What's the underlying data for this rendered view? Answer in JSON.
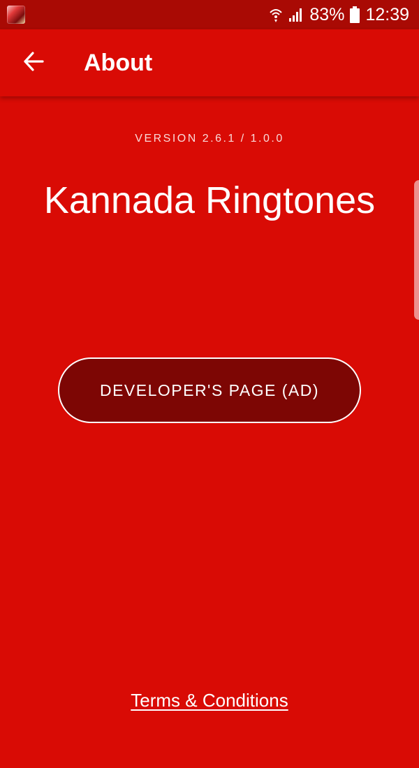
{
  "status_bar": {
    "battery_percent": "83%",
    "time": "12:39",
    "icons": [
      "notification-app-icon",
      "wifi-icon",
      "signal-icon",
      "battery-icon"
    ]
  },
  "app_bar": {
    "title": "About",
    "back_icon": "arrow-back-icon"
  },
  "about": {
    "version": "VERSION 2.6.1 / 1.0.0",
    "app_name": "Kannada Ringtones",
    "developer_button_label": "DEVELOPER'S PAGE (AD)",
    "terms_link": "Terms & Conditions"
  },
  "colors": {
    "background": "#d90b05",
    "status_bar": "#a90a04",
    "button_fill": "#7d0604",
    "text": "#ffffff"
  }
}
